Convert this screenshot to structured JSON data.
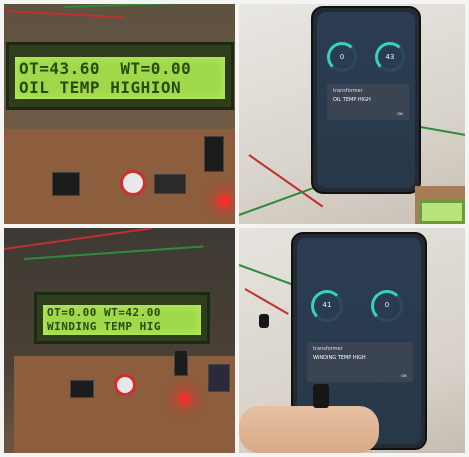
{
  "panels": {
    "top_left": {
      "lcd_line1": "OT=43.60  WT=0.00",
      "lcd_line2": "OIL TEMP HIGHION"
    },
    "top_right": {
      "app_title": "",
      "gauge1_value": "0",
      "gauge2_value": "43",
      "dialog_title": "transformer",
      "dialog_message": "OIL TEMP HIGH",
      "dialog_button": "OK"
    },
    "bottom_left": {
      "lcd_line1": "OT=0.00 WT=42.00",
      "lcd_line2": "WINDING TEMP HIG"
    },
    "bottom_right": {
      "app_title": "",
      "gauge1_value": "41",
      "gauge2_value": "0",
      "dialog_title": "transformer",
      "dialog_message": "WINDING TEMP HIGH",
      "dialog_button": "OK"
    }
  },
  "colors": {
    "lcd_backlight": "#9fd84a",
    "led_red": "#ff2a2a",
    "app_accent": "#3ad0c0"
  }
}
